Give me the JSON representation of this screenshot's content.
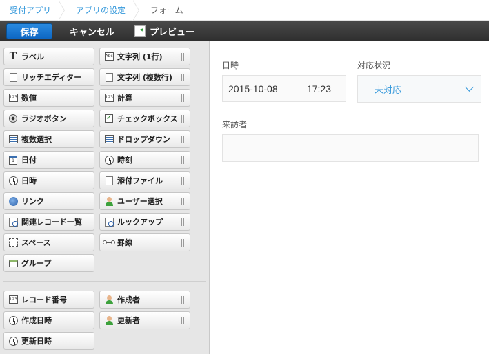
{
  "breadcrumb": [
    "受付アプリ",
    "アプリの設定",
    "フォーム"
  ],
  "toolbar": {
    "save": "保存",
    "cancel": "キャンセル",
    "preview": "プレビュー"
  },
  "palette": {
    "fields": [
      {
        "label": "ラベル",
        "icon": "label-icon"
      },
      {
        "label": "文字列 (1行)",
        "icon": "text-single-icon"
      },
      {
        "label": "リッチエディター",
        "icon": "rich-editor-icon"
      },
      {
        "label": "文字列 (複数行)",
        "icon": "text-multi-icon"
      },
      {
        "label": "数値",
        "icon": "number-icon"
      },
      {
        "label": "計算",
        "icon": "calc-icon"
      },
      {
        "label": "ラジオボタン",
        "icon": "radio-icon"
      },
      {
        "label": "チェックボックス",
        "icon": "checkbox-icon"
      },
      {
        "label": "複数選択",
        "icon": "multi-select-icon"
      },
      {
        "label": "ドロップダウン",
        "icon": "dropdown-icon"
      },
      {
        "label": "日付",
        "icon": "calendar-icon"
      },
      {
        "label": "時刻",
        "icon": "clock-icon"
      },
      {
        "label": "日時",
        "icon": "datetime-icon"
      },
      {
        "label": "添付ファイル",
        "icon": "attachment-icon"
      },
      {
        "label": "リンク",
        "icon": "link-icon"
      },
      {
        "label": "ユーザー選択",
        "icon": "user-icon"
      },
      {
        "label": "関連レコード一覧",
        "icon": "related-records-icon"
      },
      {
        "label": "ルックアップ",
        "icon": "lookup-icon"
      },
      {
        "label": "スペース",
        "icon": "space-icon"
      },
      {
        "label": "罫線",
        "icon": "rule-icon"
      },
      {
        "label": "グループ",
        "icon": "group-icon"
      }
    ],
    "system_fields": [
      {
        "label": "レコード番号",
        "icon": "record-number-icon"
      },
      {
        "label": "作成者",
        "icon": "user-icon"
      },
      {
        "label": "作成日時",
        "icon": "clock-icon"
      },
      {
        "label": "更新者",
        "icon": "user-icon"
      },
      {
        "label": "更新日時",
        "icon": "clock-icon"
      }
    ],
    "icon_text": {
      "abc": "Abc",
      "num": "123",
      "cal": "1"
    }
  },
  "form": {
    "datetime": {
      "label": "日時",
      "date": "2015-10-08",
      "time": "17:23"
    },
    "status": {
      "label": "対応状況",
      "value": "未対応"
    },
    "visitor": {
      "label": "来訪者",
      "value": ""
    }
  },
  "colors": {
    "accent": "#3498db",
    "save": "#0d66c2",
    "toolbar": "#333333",
    "palette_bg": "#e6e6e6"
  }
}
